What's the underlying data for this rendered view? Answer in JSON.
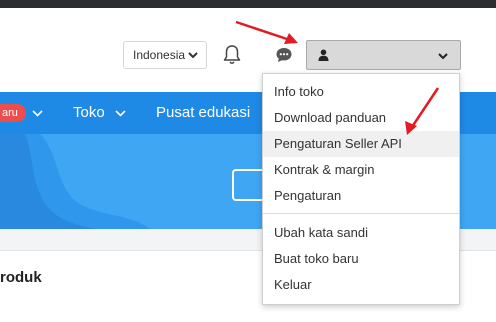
{
  "header": {
    "language_label": "Indonesia",
    "account_name": ""
  },
  "nav": {
    "badge": "aru",
    "items": [
      "Toko",
      "Pusat edukasi"
    ]
  },
  "dropdown": {
    "items": [
      "Info toko",
      "Download panduan",
      "Pengaturan Seller API",
      "Kontrak & margin",
      "Pengaturan",
      "Ubah kata sandi",
      "Buat toko baru",
      "Keluar"
    ],
    "highlighted_index": 2
  },
  "card": {
    "title": "roduk"
  },
  "colors": {
    "nav_blue": "#1e8ae6",
    "banner_blue": "#3fa6f4",
    "badge_red": "#ee4d4d",
    "annotation_arrow": "#e31b23"
  },
  "icons": [
    "bell-icon",
    "chat-icon",
    "user-icon",
    "chevron-down-icon"
  ]
}
